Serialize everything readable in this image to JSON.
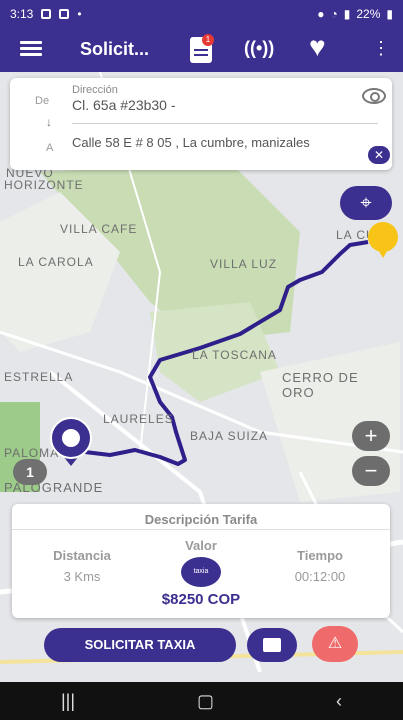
{
  "status": {
    "time": "3:13",
    "battery": "22%"
  },
  "appbar": {
    "title": "Solicit...",
    "badge": "1"
  },
  "addresses": {
    "from_label": "De",
    "to_label": "A",
    "direccion_label": "Dirección",
    "origin": "Cl. 65a #23b30 -",
    "destination": "Calle 58 E # 8 05 , La cumbre, manizales"
  },
  "map": {
    "labels": [
      "NUEVO",
      "HORIZONTE",
      "VILLA CAFE",
      "LA CAROLA",
      "VILLA LUZ",
      "LA CUM",
      "LA TOSCANA",
      "CERRO DE ORO",
      "LAURELES",
      "BAJA SUIZA",
      "PALOMAS",
      "ESTRELLA",
      "PALOGRANDE"
    ],
    "route_color": "#2e1f8a",
    "pin_number": "1"
  },
  "tarifa": {
    "title": "Descripción Tarifa",
    "distance_label": "Distancia",
    "distance_value": "3 Kms",
    "value_label": "Valor",
    "price": "$8250 COP",
    "time_label": "Tiempo",
    "time_value": "00:12:00",
    "logo_text": "taxia"
  },
  "actions": {
    "request": "SOLICITAR TAXIA"
  },
  "colors": {
    "primary": "#3b2f8f",
    "sos": "#ef6b6b",
    "pin": "#f7c417"
  }
}
